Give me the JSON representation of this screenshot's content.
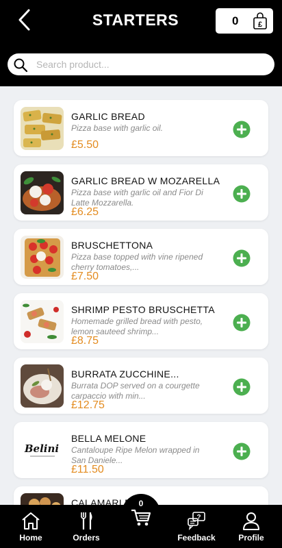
{
  "header": {
    "title": "STARTERS",
    "cart_count": "0",
    "currency_symbol": "£"
  },
  "search": {
    "placeholder": "Search product..."
  },
  "products": [
    {
      "name": "GARLIC BREAD",
      "description": "Pizza base with garlic oil.",
      "price": "£5.50"
    },
    {
      "name": "GARLIC BREAD W MOZARELLA",
      "description": "Pizza base with garlic oil and Fior Di Latte Mozzarella.",
      "price": "£6.25"
    },
    {
      "name": "BRUSCHETTONA",
      "description": "Pizza base topped with vine ripened cherry tomatoes,...",
      "price": "£7.50"
    },
    {
      "name": "SHRIMP PESTO BRUSCHETTA",
      "description": "Homemade grilled bread with pesto, lemon sauteed shrimp...",
      "price": "£8.75"
    },
    {
      "name": "BURRATA ZUCCHINE...",
      "description": "Burrata DOP served on a courgette carpaccio with min...",
      "price": "£12.75"
    },
    {
      "name": "BELLA MELONE",
      "description": "Cantaloupe Ripe Melon wrapped in San Daniele...",
      "price": "£11.50",
      "logo_text": "Belini"
    },
    {
      "name": "CALAMARI F...",
      "description": "",
      "price": ""
    }
  ],
  "bottom_nav": {
    "home": "Home",
    "orders": "Orders",
    "cart_count": "0",
    "feedback": "Feedback",
    "profile": "Profile"
  },
  "colors": {
    "header_bg": "#000000",
    "accent_green": "#4caf50",
    "price_orange": "#e38b1f"
  },
  "icons": [
    "back-chevron-icon",
    "shopping-bag-icon",
    "search-icon",
    "add-circle-icon",
    "home-icon",
    "cutlery-icon",
    "cart-icon",
    "feedback-icon",
    "profile-icon"
  ]
}
